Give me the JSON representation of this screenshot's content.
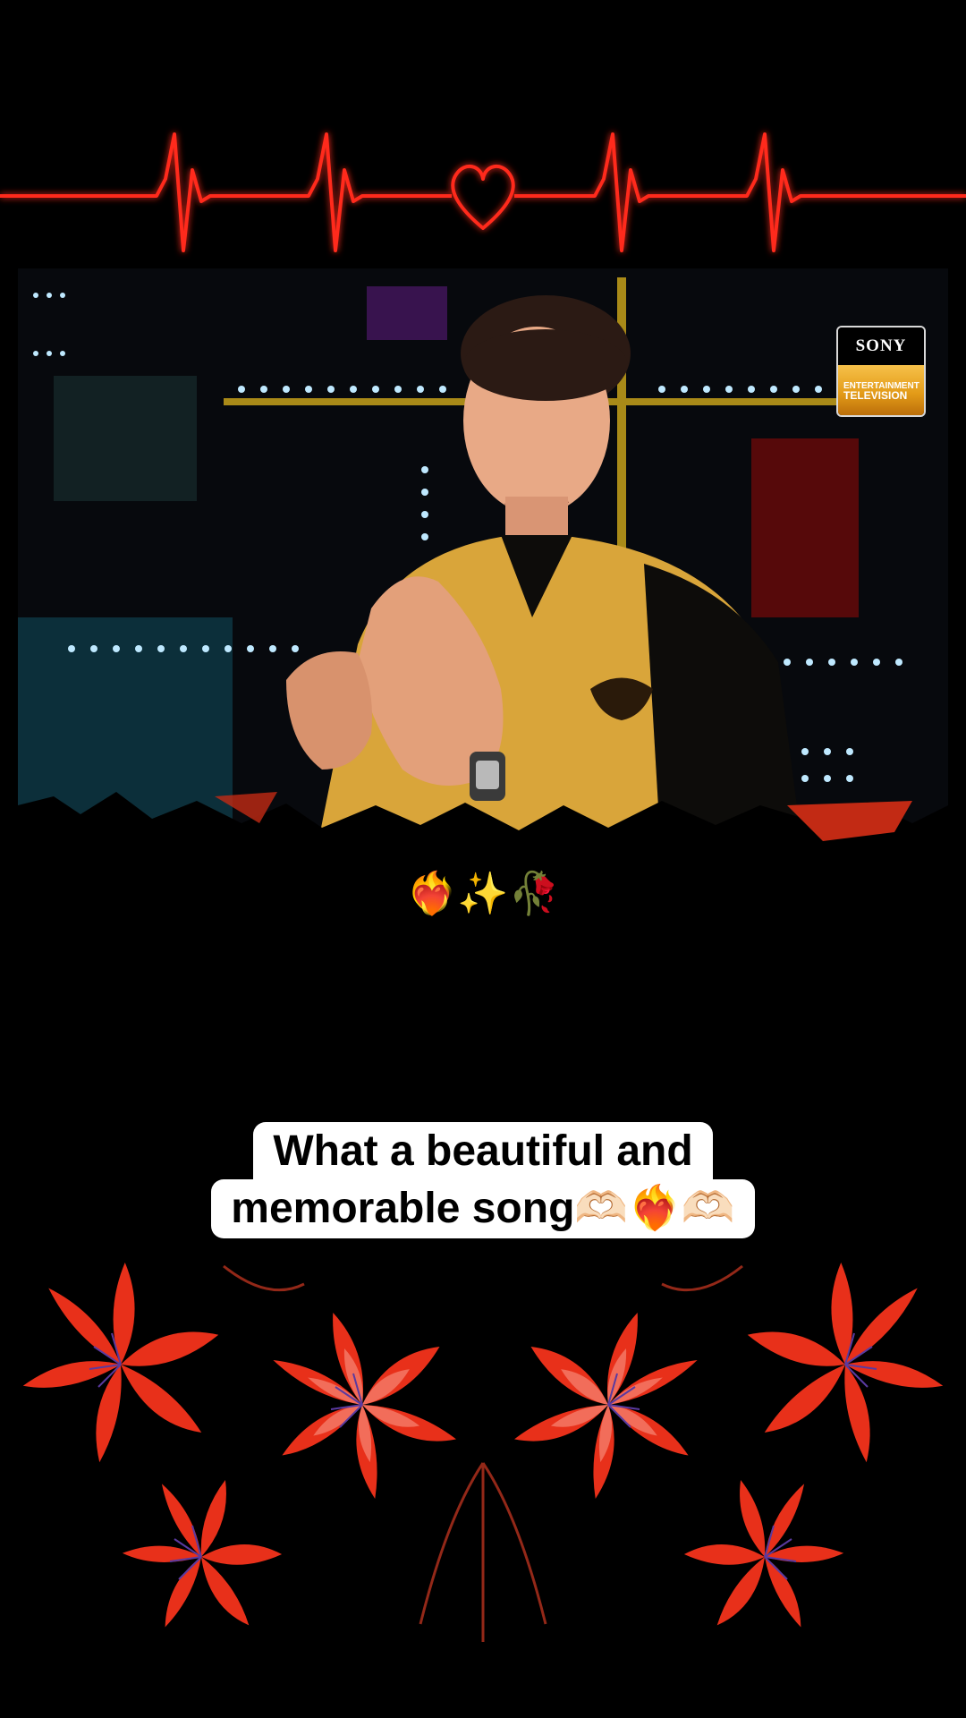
{
  "overlay": {
    "emoji_row": "❤️‍🔥✨🥀",
    "caption_line1": "What a beautiful and",
    "caption_line2": "memorable song🫶🏻❤️‍🔥🫶🏻"
  },
  "logo": {
    "brand": "SONY",
    "sub_line1": "ENTERTAINMENT",
    "sub_line2": "TELEVISION"
  },
  "colors": {
    "background": "#000000",
    "heartbeat": "#ff2a1a",
    "flower": "#e8301a",
    "caption_bg": "#ffffff"
  }
}
